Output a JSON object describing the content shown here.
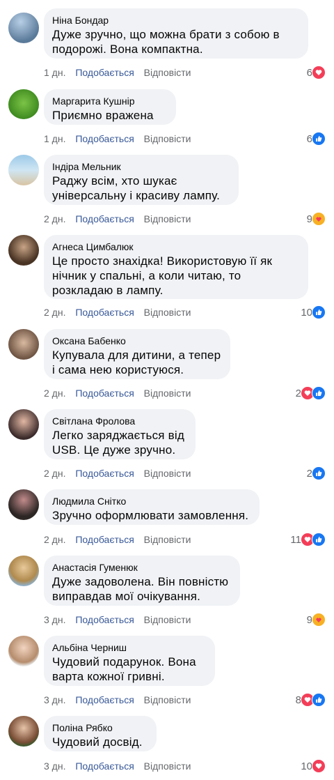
{
  "meta_labels": {
    "like": "Подобається",
    "reply": "Відповісти"
  },
  "comments": [
    {
      "author": "Ніна Бондар",
      "text": "Дуже зручно, що можна брати з собою в подорожі. Вона компактна.",
      "time": "1 дн.",
      "count": "6",
      "reactions": [
        "love"
      ]
    },
    {
      "author": "Маргарита Кушнір",
      "text": "Приємно вражена",
      "time": "1 дн.",
      "count": "6",
      "reactions": [
        "like"
      ]
    },
    {
      "author": "Індіра Мельник",
      "text": "Раджу всім, хто шукає універсальну і красиву лампу.",
      "time": "2 дн.",
      "count": "9",
      "reactions": [
        "care"
      ]
    },
    {
      "author": "Агнеса Цимбалюк",
      "text": "Це просто знахідка! Використовую її як нічник у спальні, а коли читаю, то розкладаю в лампу.",
      "time": "2 дн.",
      "count": "10",
      "reactions": [
        "like"
      ]
    },
    {
      "author": "Оксана Бабенко",
      "text": "Купувала для дитини, а тепер і сама нею користуюся.",
      "time": "2 дн.",
      "count": "2",
      "reactions": [
        "love",
        "like"
      ]
    },
    {
      "author": "Світлана Фролова",
      "text": "Легко заряджається від USB. Це дуже зручно.",
      "time": "2 дн.",
      "count": "2",
      "reactions": [
        "like"
      ]
    },
    {
      "author": "Людмила Снітко",
      "text": "Зручно оформлювати замовлення.",
      "time": "2 дн.",
      "count": "11",
      "reactions": [
        "love",
        "like"
      ]
    },
    {
      "author": "Анастасія Гуменюк",
      "text": "Дуже задоволена. Він повністю виправдав мої очікування.",
      "time": "3 дн.",
      "count": "9",
      "reactions": [
        "care"
      ]
    },
    {
      "author": "Альбіна Черниш",
      "text": "Чудовий подарунок. Вона варта кожної гривні.",
      "time": "3 дн.",
      "count": "8",
      "reactions": [
        "love",
        "like"
      ]
    },
    {
      "author": "Поліна Рябко",
      "text": "Чудовий досвід.",
      "time": "3 дн.",
      "count": "10",
      "reactions": [
        "love"
      ]
    }
  ]
}
